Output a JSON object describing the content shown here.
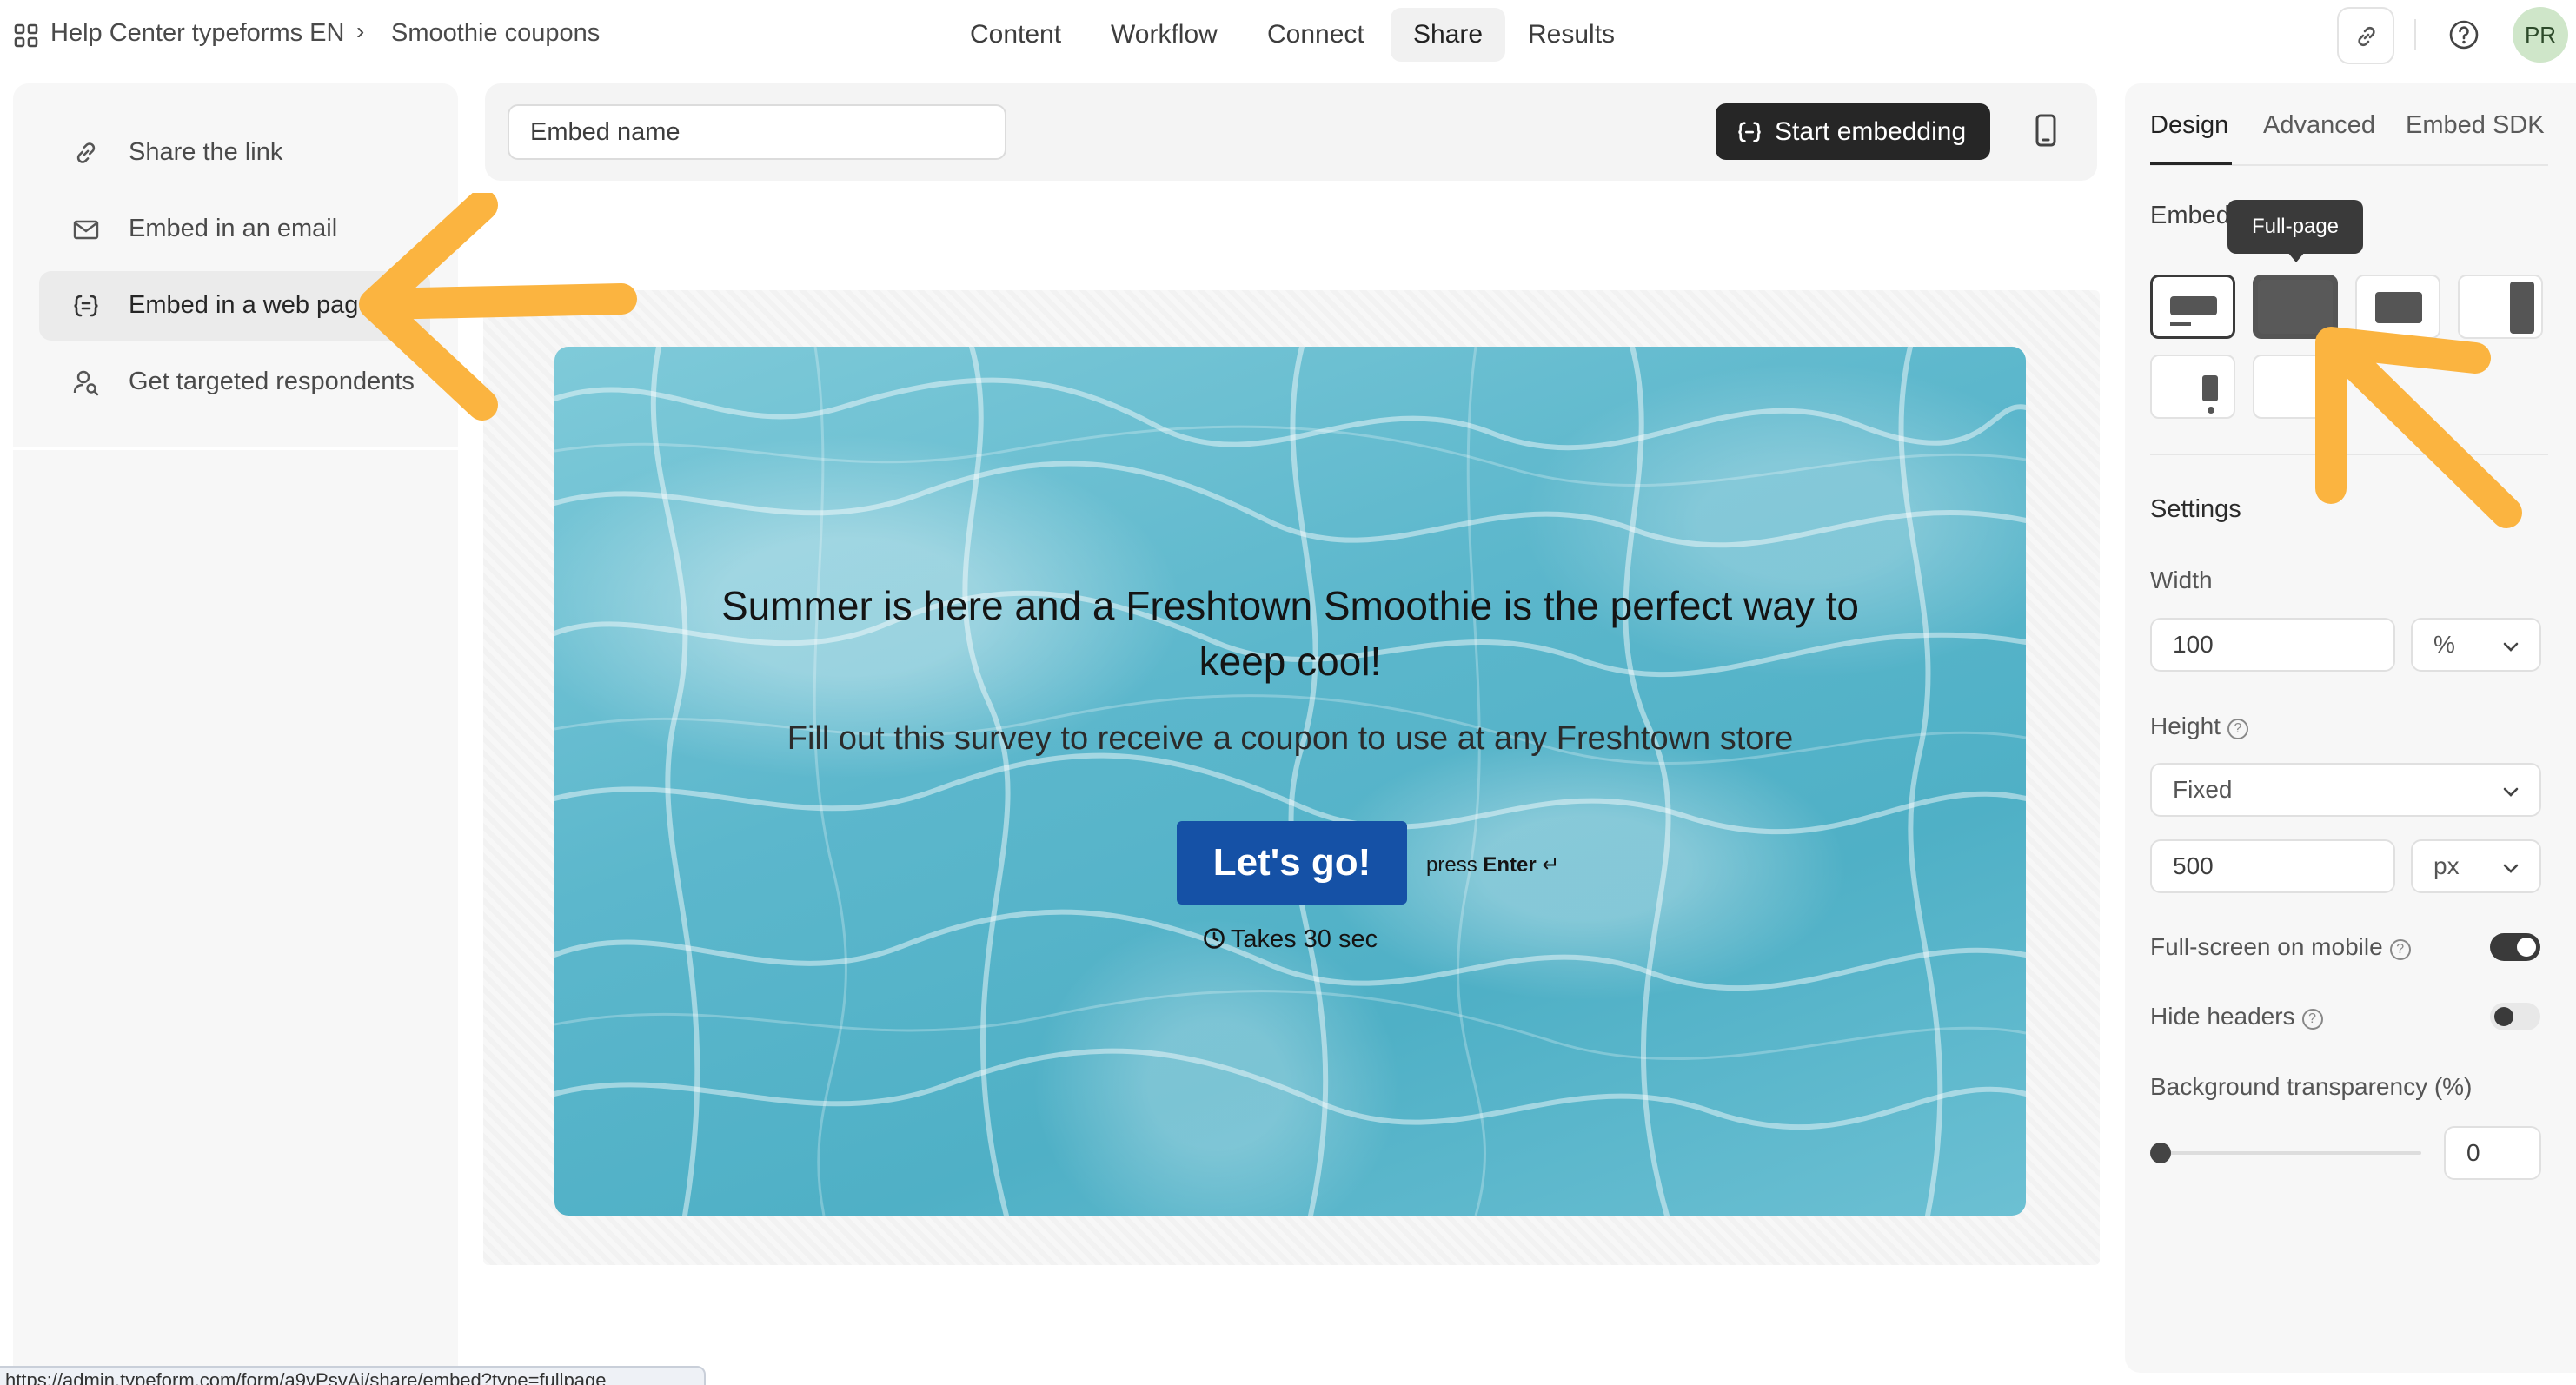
{
  "breadcrumb": {
    "workspace": "Help Center typeforms EN",
    "separator": "›",
    "form": "Smoothie coupons"
  },
  "nav": {
    "tabs": [
      {
        "label": "Content"
      },
      {
        "label": "Workflow"
      },
      {
        "label": "Connect"
      },
      {
        "label": "Share",
        "active": true
      },
      {
        "label": "Results"
      }
    ]
  },
  "header_icons": {
    "link": "link-icon",
    "help": "help-circle-icon",
    "avatar": "PR"
  },
  "sidebar": {
    "items": [
      {
        "label": "Share the link",
        "icon": "link-icon"
      },
      {
        "label": "Embed in an email",
        "icon": "mail-icon"
      },
      {
        "label": "Embed in a web page",
        "icon": "code-braces-icon",
        "active": true
      },
      {
        "label": "Get targeted respondents",
        "icon": "people-search-icon"
      }
    ]
  },
  "toolbar": {
    "embed_name_value": "Embed name",
    "start_embedding_label": "Start embedding",
    "device_icon": "mobile-device-icon"
  },
  "preview": {
    "title": "Summer is here and a Freshtown Smoothie is the perfect way to keep cool!",
    "subtitle": "Fill out this survey to receive a coupon to use at any Freshtown store",
    "button_label": "Let's go!",
    "press": "press",
    "enter": "Enter",
    "enter_icon": "↵",
    "duration": "Takes 30 sec",
    "button_color": "#1551a6"
  },
  "right_panel": {
    "tabs": [
      {
        "label": "Design",
        "active": true
      },
      {
        "label": "Advanced"
      },
      {
        "label": "Embed SDK"
      }
    ],
    "embed_type_label": "Embed",
    "tooltip": "Full-page",
    "settings_title": "Settings",
    "width_label": "Width",
    "width_value": "100",
    "width_unit": "%",
    "height_label": "Height",
    "height_mode": "Fixed",
    "height_value": "500",
    "height_unit": "px",
    "fullscreen_mobile_label": "Full-screen on mobile",
    "fullscreen_mobile_on": true,
    "hide_headers_label": "Hide headers",
    "hide_headers_on": false,
    "bg_transparency_label": "Background transparency (%)",
    "bg_transparency_value": "0",
    "bg_transparency_fraction": 0
  },
  "status_bar": {
    "url": "https://admin.typeform.com/form/a9yPsyAj/share/embed?type=fullpage"
  },
  "colors": {
    "annotation_arrow": "#fbb440",
    "dark_button": "#262626",
    "toggle_on": "#3a3a3a"
  }
}
